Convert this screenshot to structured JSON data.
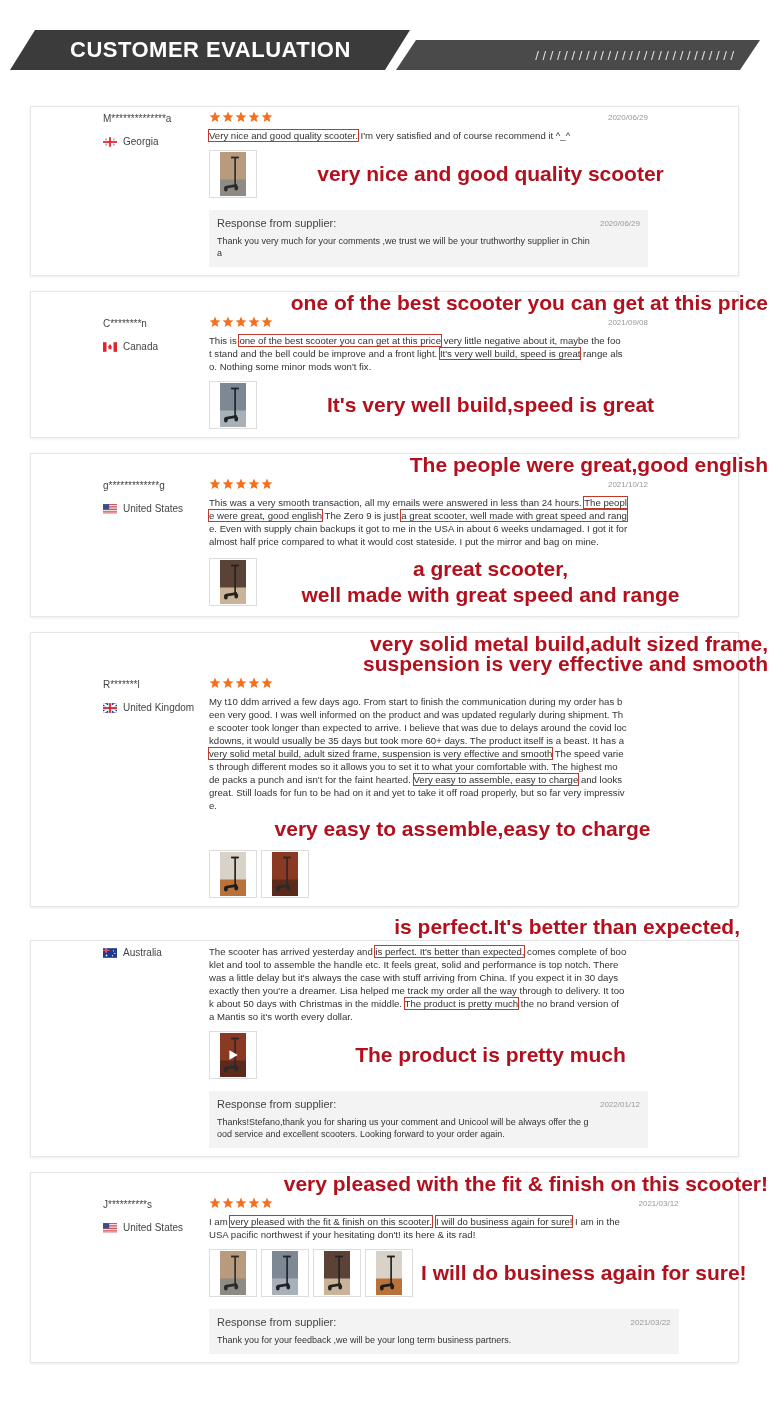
{
  "header": {
    "title": "CUSTOMER EVALUATION",
    "slashes": "/ / / / / / / / / / / / / / / / / / / / / / / / / / / /"
  },
  "cards": [
    {
      "name": "M**************a",
      "country": "Georgia",
      "kind": "georgia",
      "stars": 5,
      "date": "2020/06/29",
      "lines": [
        [
          {
            "t": "Very nice and good quality scooter.",
            "boxed": true
          },
          {
            "t": " I'm very satisfied and of course recommend it ^_^",
            "boxed": false
          }
        ]
      ],
      "photos": [
        {
          "video": false
        }
      ],
      "callouts": [
        {
          "text": "very nice and good quality scooter",
          "kind": "beside_photos"
        }
      ],
      "response": {
        "title": "Response from supplier:",
        "date": "2020/06/29",
        "lines": [
          "Thank you very much for your comments ,we trust we will be your truthworthy supplier in Chin",
          "a"
        ]
      }
    },
    {
      "name": "C********n",
      "country": "Canada",
      "kind": "canada",
      "stars": 5,
      "date": "2021/09/08",
      "lines": [
        [
          {
            "t": "This is ",
            "boxed": false
          },
          {
            "t": "one of the best scooter you can get at this price",
            "boxed": true
          },
          {
            "t": " very little negative about it, maybe the foo",
            "boxed": false
          }
        ],
        [
          {
            "t": "t stand and the bell could be improve and a front light. ",
            "boxed": false
          },
          {
            "t": "It's very well build, speed is great",
            "boxed": true
          },
          {
            "t": " range als",
            "boxed": false
          }
        ],
        [
          {
            "t": "o. Nothing some minor mods won't fix.",
            "boxed": false
          }
        ]
      ],
      "photos": [
        {
          "video": false
        }
      ],
      "callouts": [
        {
          "text": "one of the best scooter you can get at this price",
          "kind": "top"
        },
        {
          "text": "It's very well build,speed is great",
          "kind": "beside_photos"
        }
      ]
    },
    {
      "name": "g*************g",
      "country": "United States",
      "kind": "us",
      "stars": 5,
      "date": "2021/10/12",
      "lines": [
        [
          {
            "t": "This was a very smooth transaction, all my emails were answered in less than 24 hours. ",
            "boxed": false
          },
          {
            "t": "The peopl",
            "boxed": true
          }
        ],
        [
          {
            "t": "e were great, good english",
            "boxed": true
          },
          {
            "t": " The Zero 9 is just ",
            "boxed": false
          },
          {
            "t": "a great scooter, well made with great speed and rang",
            "boxed": true
          }
        ],
        [
          {
            "t": "e. Even with supply chain backups it got to me in the USA in about 6 weeks undamaged. I got it for",
            "boxed": false
          }
        ],
        [
          {
            "t": "almost half price compared to what it would cost stateside. I put the mirror and bag on mine.",
            "boxed": false
          }
        ]
      ],
      "photos": [
        {
          "video": false
        }
      ],
      "callouts": [
        {
          "text": "The people were great,good english",
          "kind": "top"
        },
        {
          "text": "a great scooter,",
          "kind": "beside_photos"
        },
        {
          "text": "well made with great speed and range",
          "kind": "beside_photos"
        }
      ]
    },
    {
      "name": "R*******l",
      "country": "United Kingdom",
      "kind": "uk",
      "stars": 5,
      "lines": [
        [
          {
            "t": "My t10 ddm arrived a few days ago. From start to finish the communication during my order has b",
            "boxed": false
          }
        ],
        [
          {
            "t": "een very good. I was well informed on the product and was updated regularly during shipment. Th",
            "boxed": false
          }
        ],
        [
          {
            "t": "e scooter took longer than expected to arrive. I believe that was due to delays around the covid loc",
            "boxed": false
          }
        ],
        [
          {
            "t": "kdowns, it would usually be 35 days but took more 60+ days. The product itself is a beast. It has a",
            "boxed": false
          }
        ],
        [
          {
            "t": "very solid metal build, adult sized frame, suspension is very effective and smooth",
            "boxed": true
          },
          {
            "t": " The speed varie",
            "boxed": false
          }
        ],
        [
          {
            "t": "s through different modes so it allows you to set it to what your comfortable with. The highest mo",
            "boxed": false
          }
        ],
        [
          {
            "t": "de packs a punch and isn't for the faint hearted. ",
            "boxed": false
          },
          {
            "t": "Very easy to assemble, easy to charge",
            "boxed": true
          },
          {
            "t": " and looks",
            "boxed": false
          }
        ],
        [
          {
            "t": "great. Still loads for fun to be had on it and yet to take it off road properly, but so far very impressiv",
            "boxed": false
          }
        ],
        [
          {
            "t": "e.",
            "boxed": false
          }
        ]
      ],
      "photos": [
        {
          "video": false
        },
        {
          "video": false
        }
      ],
      "callouts": [
        {
          "text": "very solid metal build,adult sized frame,",
          "kind": "top"
        },
        {
          "text": "suspension is very effective and smooth",
          "kind": "top"
        },
        {
          "text": "very easy to assemble,easy to charge",
          "kind": "after_text"
        }
      ]
    },
    {
      "country": "Australia",
      "kind": "australia",
      "lines": [
        [
          {
            "t": "The scooter has arrived yesterday and ",
            "boxed": false
          },
          {
            "t": "is perfect. It's better than expected,",
            "boxed": true
          },
          {
            "t": " comes complete of boo",
            "boxed": false
          }
        ],
        [
          {
            "t": "klet and tool to assemble the handle etc. It feels great, solid and performance is top notch. There",
            "boxed": false
          }
        ],
        [
          {
            "t": "was a little delay but it's always the case with stuff arriving from China. If you expect it in 30 days",
            "boxed": false
          }
        ],
        [
          {
            "t": "exactly then you're a dreamer. Lisa helped me track my order all the way through to delivery. It too",
            "boxed": false
          }
        ],
        [
          {
            "t": "k about 50 days with Christmas in the middle. ",
            "boxed": false
          },
          {
            "t": "The product is pretty much",
            "boxed": true
          },
          {
            "t": " the no brand version of",
            "boxed": false
          }
        ],
        [
          {
            "t": "a Mantis so it's worth every dollar.",
            "boxed": false
          }
        ]
      ],
      "photos": [
        {
          "video": true
        }
      ],
      "callouts": [
        {
          "text": "is perfect.It's better than expected,",
          "kind": "above_card"
        },
        {
          "text": "The product is pretty much",
          "kind": "beside_photos"
        }
      ],
      "response": {
        "title": "Response from supplier:",
        "date": "2022/01/12",
        "lines": [
          "Thanks!Stefano,thank you for sharing us your comment and Unicool will be always offer the g",
          "ood service and excellent scooters. Looking forward to your order again."
        ]
      }
    },
    {
      "name": "J**********s",
      "country": "United States",
      "kind": "us",
      "stars": 5,
      "date": "2021/03/12",
      "lines": [
        [
          {
            "t": "I am ",
            "boxed": false
          },
          {
            "t": "very pleased with the fit & finish on this scooter.",
            "boxed": true
          },
          {
            "t": "I will do business again for sure!",
            "boxed": true
          },
          {
            "t": " I am in the",
            "boxed": false
          }
        ],
        [
          {
            "t": "USA pacific northwest if your hesitating don't! its here & its rad!",
            "boxed": false
          }
        ]
      ],
      "photos": [
        {
          "video": false
        },
        {
          "video": false
        },
        {
          "video": false
        },
        {
          "video": false
        }
      ],
      "callouts": [
        {
          "text": "very pleased with the fit & finish on this scooter!",
          "kind": "top"
        },
        {
          "text": "I will do business again for sure!",
          "kind": "beside_photos"
        }
      ],
      "response": {
        "title": "Response from supplier:",
        "date": "2021/03/22",
        "lines": [
          "Thank you for your feedback ,we will be your long term business partners."
        ]
      }
    }
  ]
}
